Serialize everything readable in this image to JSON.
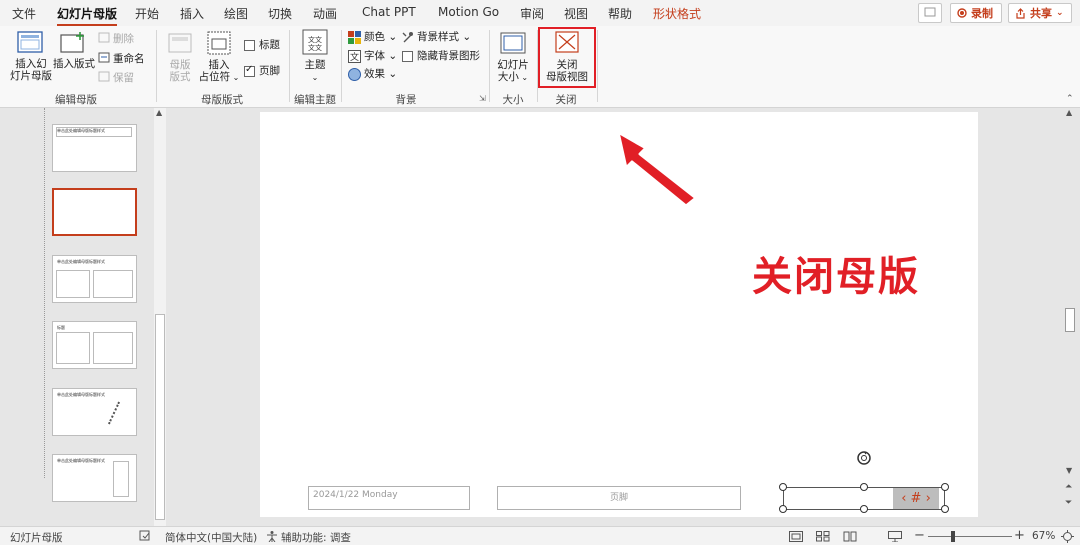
{
  "tabs": [
    "文件",
    "幻灯片母版",
    "开始",
    "插入",
    "绘图",
    "切换",
    "动画",
    "Chat PPT",
    "Motion Go",
    "审阅",
    "视图",
    "帮助",
    "形状格式"
  ],
  "titlebar": {
    "record": "录制",
    "share": "共享"
  },
  "ribbon": {
    "insert_master": [
      "插入幻",
      "灯片母版"
    ],
    "insert_layout": "插入版式",
    "delete": "删除",
    "rename": "重命名",
    "preserve": "保留",
    "group_edit_master": "编辑母版",
    "master_layout": [
      "母版",
      "版式"
    ],
    "insert_placeholder": [
      "插入",
      "占位符"
    ],
    "title_cb": "标题",
    "footer_cb": "页脚",
    "group_master_layout": "母版版式",
    "theme": "主题",
    "group_edit_theme": "编辑主题",
    "colors": "颜色",
    "fonts": "字体",
    "effects": "效果",
    "bg_styles": "背景样式",
    "hide_bg": "隐藏背景图形",
    "group_background": "背景",
    "slide_size": [
      "幻灯片",
      "大小"
    ],
    "group_size": "大小",
    "close_master": [
      "关闭",
      "母版视图"
    ],
    "group_close": "关闭"
  },
  "slide": {
    "date": "2024/1/22  Monday",
    "footer": "页脚",
    "number": "‹ # ›"
  },
  "thumb_texts": [
    "单击此处编辑母版标题样式",
    "单击此处编辑母版标题样式",
    "单击此处编辑母版标题样式",
    "标题",
    "单击此处编辑母版标题样式"
  ],
  "overlay": "关闭母版",
  "status": {
    "view": "幻灯片母版",
    "language": "简体中文(中国大陆)",
    "accessibility": "辅助功能: 调查",
    "zoom": "67%"
  }
}
